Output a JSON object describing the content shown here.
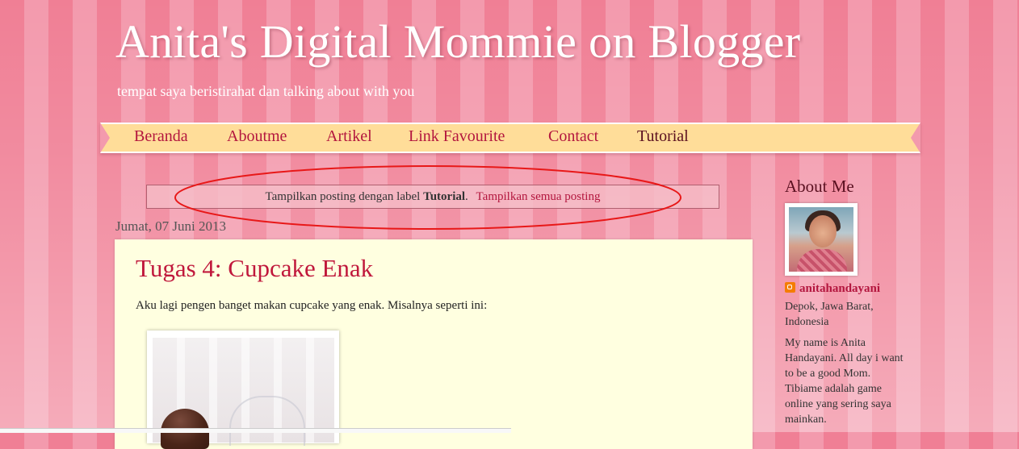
{
  "header": {
    "title": "Anita's Digital Mommie on Blogger",
    "description": "tempat saya beristirahat dan talking about with you"
  },
  "nav": {
    "items": [
      {
        "label": "Beranda"
      },
      {
        "label": "Aboutme"
      },
      {
        "label": "Artikel"
      },
      {
        "label": "Link Favourite"
      },
      {
        "label": "Contact"
      },
      {
        "label": "Tutorial",
        "active": true
      }
    ]
  },
  "status": {
    "prefix": "Tampilkan posting dengan label",
    "label": "Tutorial",
    "period": ".",
    "show_all": "Tampilkan semua posting"
  },
  "post": {
    "date": "Jumat, 07 Juni 2013",
    "title": "Tugas 4: Cupcake Enak",
    "body": "Aku lagi pengen banget makan cupcake yang enak.  Misalnya seperti ini:"
  },
  "sidebar": {
    "about_title": "About Me",
    "profile_name": "anitahandayani",
    "location": "Depok, Jawa Barat, Indonesia",
    "about_text": "My name is Anita Handayani. All day i want to be a good Mom. Tibiame adalah game online yang sering saya mainkan."
  },
  "colors": {
    "stripe_dark": "#f07f95",
    "stripe_light": "#f39aad",
    "nav_background": "#ffdd99",
    "link": "#b3163e",
    "post_background": "#ffffe0",
    "annotation": "#e81818"
  }
}
